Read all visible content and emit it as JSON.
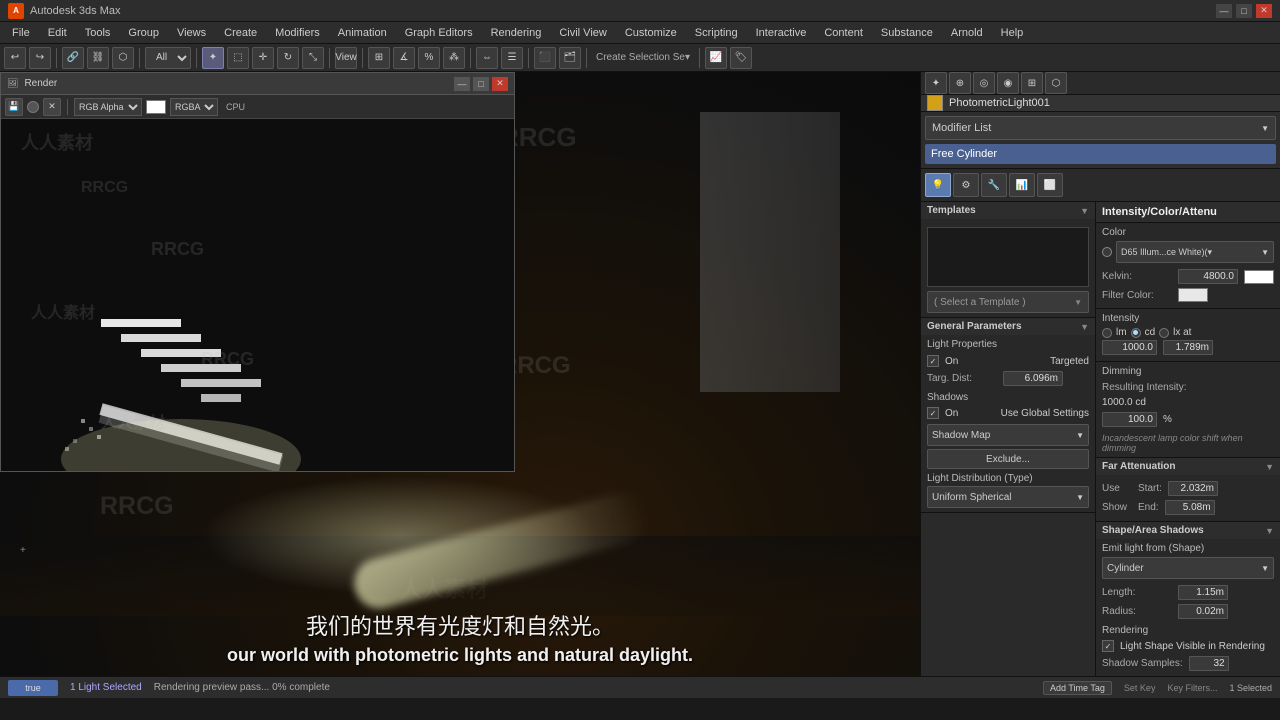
{
  "titleBar": {
    "logo": "A",
    "title": "Autodesk 3ds Max",
    "minimize": "—",
    "maximize": "□",
    "close": "✕"
  },
  "menuBar": {
    "items": [
      "File",
      "Edit",
      "Tools",
      "Group",
      "Views",
      "Create",
      "Modifiers",
      "Animation",
      "Graph Editors",
      "Rendering",
      "Civil View",
      "Customize",
      "Scripting",
      "Interactive",
      "Content",
      "Substance",
      "Arnold",
      "Help"
    ]
  },
  "renderWindow": {
    "title": "Render",
    "channelLabel": "RGB Alpha",
    "displayLabel": "RGBA",
    "processorLabel": "CPU"
  },
  "objectNameBar": {
    "objectName": "PhotometricLight001"
  },
  "modifierList": {
    "label": "Modifier List",
    "selectedItem": "Free Cylinder"
  },
  "paramTabs": {
    "tabs": [
      "💡",
      "⚙",
      "🔧",
      "📊",
      "🔲"
    ]
  },
  "intensityPanel": {
    "title": "Intensity/Color/Attenu",
    "colorLabel": "Color",
    "colorPreset": "D65 Illum...ce White)(▾",
    "kelvinLabel": "Kelvin:",
    "kelvinValue": "4800.0",
    "filterColorLabel": "Filter Color:",
    "intensityLabel": "Intensity",
    "lmLabel": "lm",
    "cdLabel": "cd",
    "lxAtLabel": "lx at",
    "intensityValue": "1000.0",
    "atValue": "1.789m"
  },
  "dimmingPanel": {
    "title": "Dimming",
    "resultingLabel": "Resulting Intensity:",
    "resultingValue": "1000.0 cd",
    "percentValue": "100.0",
    "percentSymbol": "%",
    "note": "Incandescent lamp color shift when dimming"
  },
  "templatesPanel": {
    "title": "Templates",
    "selectLabel": "( Select a Template )"
  },
  "generalParams": {
    "title": "General Parameters",
    "lightPropsLabel": "Light Properties",
    "onLabel": "On",
    "targetedLabel": "Targeted",
    "targDistLabel": "Targ. Dist:",
    "targDistValue": "6.096m",
    "shadowsLabel": "Shadows",
    "shadowOnLabel": "On",
    "useGlobalLabel": "Use Global Settings",
    "shadowMapLabel": "Shadow Map",
    "excludeLabel": "Exclude...",
    "lightDistLabel": "Light Distribution (Type)",
    "uniformSphericalLabel": "Uniform Spherical"
  },
  "farAttenuation": {
    "title": "Far Attenuation",
    "useLabel": "Use",
    "showLabel": "Show",
    "startLabel": "Start:",
    "startValue": "2.032m",
    "endLabel": "End:",
    "endValue": "5.08m"
  },
  "shapeArea": {
    "title": "Shape/Area Shadows",
    "emitLabel": "Emit light from (Shape)",
    "shapeType": "Cylinder",
    "lengthLabel": "Length:",
    "lengthValue": "1.15m",
    "radiusLabel": "Radius:",
    "radiusValue": "0.02m",
    "renderingLabel": "Rendering",
    "lightShapeVisibleLabel": "Light Shape Visible in Rendering",
    "shadowSamplesLabel": "Shadow Samples:",
    "shadowSamplesValue": "32"
  },
  "statusBar": {
    "selectionText": "1 Light Selected",
    "renderText": "Rendering preview pass... 0% complete",
    "selectedRight": "1 Selected"
  },
  "bottomBar": {
    "trueLabel": "true",
    "addTimeTagLabel": "Add Time Tag",
    "setKeyLabel": "Set Key",
    "keyFiltersLabel": "Key Filters..."
  },
  "subtitles": {
    "chinese": "我们的世界有光度灯和自然光。",
    "english": "our world with photometric lights and natural daylight."
  }
}
